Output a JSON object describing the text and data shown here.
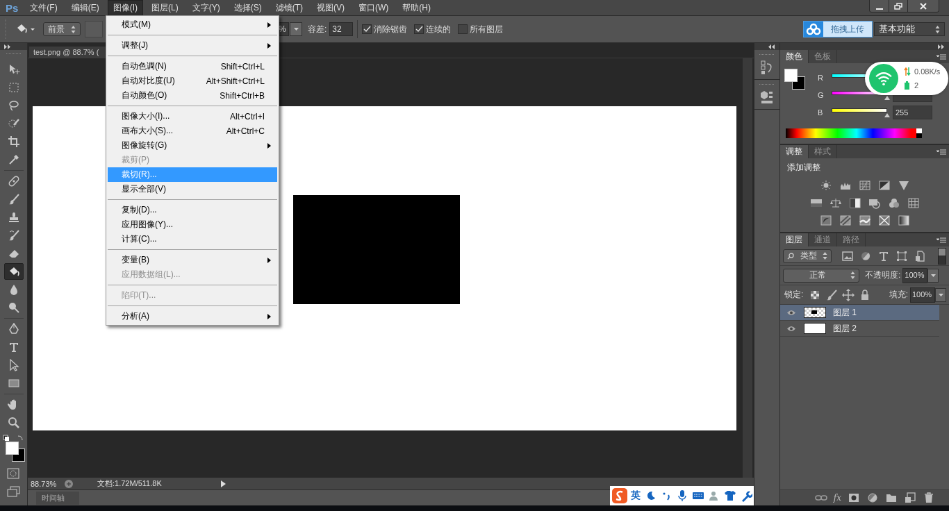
{
  "menubar": {
    "logo": "Ps",
    "items": [
      {
        "label": "文件(F)",
        "selected": false
      },
      {
        "label": "编辑(E)",
        "selected": false
      },
      {
        "label": "图像(I)",
        "selected": true
      },
      {
        "label": "图层(L)",
        "selected": false
      },
      {
        "label": "文字(Y)",
        "selected": false
      },
      {
        "label": "选择(S)",
        "selected": false
      },
      {
        "label": "滤镜(T)",
        "selected": false
      },
      {
        "label": "视图(V)",
        "selected": false
      },
      {
        "label": "窗口(W)",
        "selected": false
      },
      {
        "label": "帮助(H)",
        "selected": false
      }
    ]
  },
  "options_bar": {
    "source": "前景",
    "opacity": "%",
    "tolerance_label": "容差:",
    "tolerance": "32",
    "options": [
      {
        "label": "消除锯齿",
        "checked": true
      },
      {
        "label": "连续的",
        "checked": true
      },
      {
        "label": "所有图层",
        "checked": false
      }
    ],
    "upload_button": "拖拽上传",
    "workspace": "基本功能"
  },
  "tool_groups": [
    [
      {
        "kind": "move",
        "selected": false
      },
      {
        "kind": "marquee",
        "selected": false
      },
      {
        "kind": "lasso",
        "selected": false
      },
      {
        "kind": "quick",
        "selected": false
      },
      {
        "kind": "crop",
        "selected": false
      },
      {
        "kind": "eyedropper",
        "selected": false
      }
    ],
    [
      {
        "kind": "healing",
        "selected": false
      },
      {
        "kind": "brush",
        "selected": false
      },
      {
        "kind": "stamp",
        "selected": false
      },
      {
        "kind": "history",
        "selected": false
      },
      {
        "kind": "eraser",
        "selected": false
      },
      {
        "kind": "bucket",
        "selected": true
      },
      {
        "kind": "blur",
        "selected": false
      },
      {
        "kind": "dodge",
        "selected": false
      }
    ],
    [
      {
        "kind": "pen",
        "selected": false
      },
      {
        "kind": "type",
        "selected": false
      },
      {
        "kind": "path",
        "selected": false
      },
      {
        "kind": "rect",
        "selected": false
      }
    ],
    [
      {
        "kind": "hand",
        "selected": false
      },
      {
        "kind": "zoom",
        "selected": false
      }
    ]
  ],
  "document": {
    "tab": "test.png @ 88.7% (",
    "zoom": "88.73%",
    "info": "文档:1.72M/511.8K",
    "timeline": "时间轴"
  },
  "image_menu": {
    "groups": [
      [
        {
          "label": "模式(M)",
          "submenu": true,
          "disabled": false,
          "selected": false
        }
      ],
      [
        {
          "label": "调整(J)",
          "submenu": true,
          "disabled": false,
          "selected": false
        }
      ],
      [
        {
          "label": "自动色调(N)",
          "shortcut": "Shift+Ctrl+L",
          "submenu": false,
          "disabled": false,
          "selected": false
        },
        {
          "label": "自动对比度(U)",
          "shortcut": "Alt+Shift+Ctrl+L",
          "submenu": false,
          "disabled": false,
          "selected": false
        },
        {
          "label": "自动颜色(O)",
          "shortcut": "Shift+Ctrl+B",
          "submenu": false,
          "disabled": false,
          "selected": false
        }
      ],
      [
        {
          "label": "图像大小(I)...",
          "shortcut": "Alt+Ctrl+I",
          "submenu": false,
          "disabled": false,
          "selected": false
        },
        {
          "label": "画布大小(S)...",
          "shortcut": "Alt+Ctrl+C",
          "submenu": false,
          "disabled": false,
          "selected": false
        },
        {
          "label": "图像旋转(G)",
          "submenu": true,
          "disabled": false,
          "selected": false
        },
        {
          "label": "裁剪(P)",
          "submenu": false,
          "disabled": true,
          "selected": false
        },
        {
          "label": "裁切(R)...",
          "submenu": false,
          "disabled": false,
          "selected": true
        },
        {
          "label": "显示全部(V)",
          "submenu": false,
          "disabled": false,
          "selected": false
        }
      ],
      [
        {
          "label": "复制(D)...",
          "submenu": false,
          "disabled": false,
          "selected": false
        },
        {
          "label": "应用图像(Y)...",
          "submenu": false,
          "disabled": false,
          "selected": false
        },
        {
          "label": "计算(C)...",
          "submenu": false,
          "disabled": false,
          "selected": false
        }
      ],
      [
        {
          "label": "变量(B)",
          "submenu": true,
          "disabled": false,
          "selected": false
        },
        {
          "label": "应用数据组(L)...",
          "submenu": false,
          "disabled": true,
          "selected": false
        }
      ],
      [
        {
          "label": "陷印(T)...",
          "submenu": false,
          "disabled": true,
          "selected": false
        }
      ],
      [
        {
          "label": "分析(A)",
          "submenu": true,
          "disabled": false,
          "selected": false
        }
      ]
    ]
  },
  "color_panel": {
    "tabs": [
      {
        "label": "颜色",
        "selected": true
      },
      {
        "label": "色板",
        "selected": false
      }
    ],
    "channels": [
      {
        "name": "R"
      },
      {
        "name": "G"
      },
      {
        "name": "B",
        "value": "255"
      }
    ]
  },
  "adjustments_panel": {
    "tabs": [
      {
        "label": "调整",
        "selected": true
      },
      {
        "label": "样式",
        "selected": false
      }
    ],
    "title": "添加调整"
  },
  "layers_panel": {
    "tabs": [
      {
        "label": "图层",
        "selected": true
      },
      {
        "label": "通道",
        "selected": false
      },
      {
        "label": "路径",
        "selected": false
      }
    ],
    "filter": "类型",
    "blend_mode": "正常",
    "opacity_label": "不透明度:",
    "opacity": "100%",
    "lock_label": "锁定:",
    "fill_label": "填充:",
    "fill": "100%",
    "layers": [
      {
        "name": "图层 1",
        "kind": "transparent",
        "visible": true,
        "selected": true
      },
      {
        "name": "图层 2",
        "kind": "white",
        "visible": true,
        "selected": false
      }
    ],
    "fx": "fx"
  },
  "network_widget": {
    "speed": "0.08K/s",
    "count": "2"
  },
  "ime_toolbar": {
    "mode": "英"
  }
}
